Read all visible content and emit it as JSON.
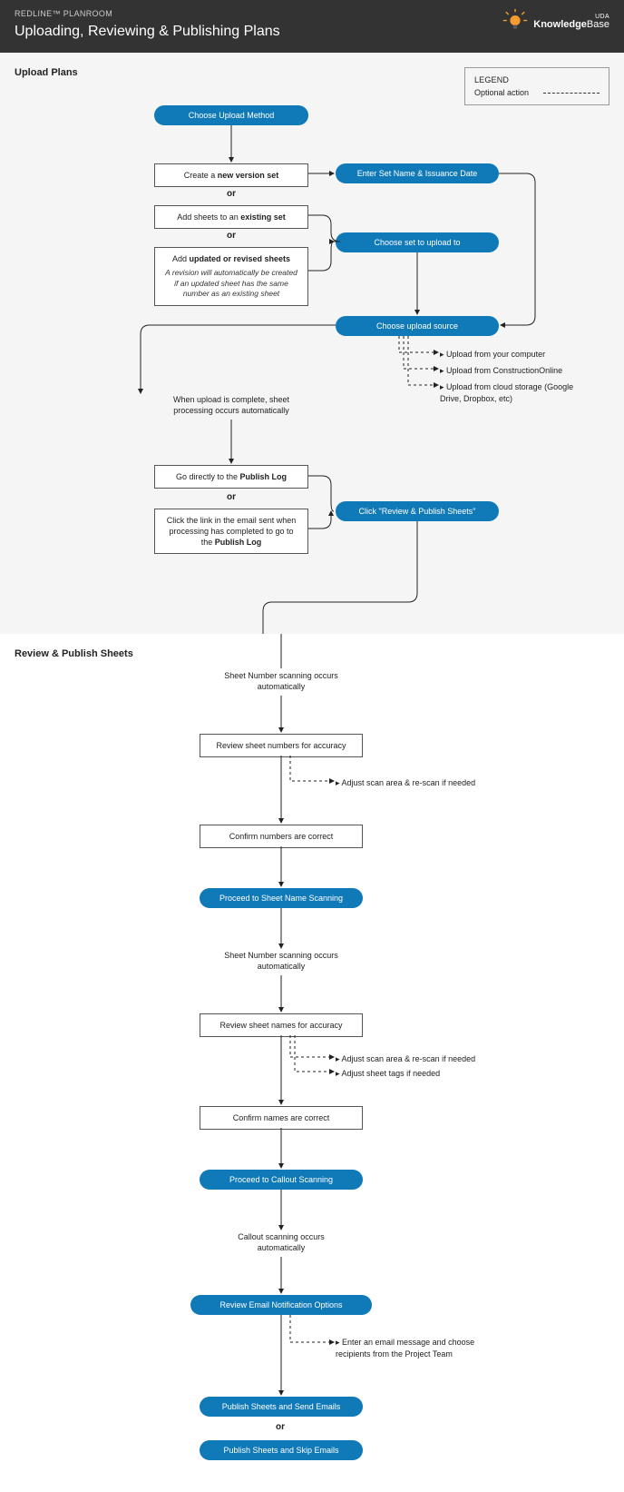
{
  "header": {
    "breadcrumb": "REDLINE™ PLANROOM",
    "title": "Uploading, Reviewing & Publishing Plans",
    "kb_small": "UDA",
    "kb_big_a": "Knowledge",
    "kb_big_b": "Base"
  },
  "legend": {
    "title": "LEGEND",
    "optional": "Optional action"
  },
  "section1": {
    "title": "Upload Plans",
    "choose_method": "Choose Upload Method",
    "new_set_pre": "Create a ",
    "new_set_bold": "new version set",
    "or": "or",
    "existing_pre": "Add sheets to an ",
    "existing_bold": "existing set",
    "revised_pre": "Add ",
    "revised_bold": "updated or revised sheets",
    "revised_sub": "A revision will automatically be created if an updated sheet has the same number as an existing sheet",
    "enter_name": "Enter Set Name & Issuance Date",
    "choose_set": "Choose set to upload to",
    "choose_source": "Choose upload source",
    "src1": "Upload from your computer",
    "src2": "Upload from ConstructionOnline",
    "src3": "Upload from cloud storage (Google Drive, Dropbox, etc)",
    "when_complete": "When upload is complete, sheet processing occurs automatically",
    "go_direct_pre": "Go directly to the ",
    "go_direct_bold": "Publish Log",
    "email_pre": "Click the link in the email sent when processing has completed to go to the ",
    "email_bold": "Publish Log",
    "review_publish": "Click \"Review & Publish Sheets\""
  },
  "section2": {
    "title": "Review & Publish Sheets",
    "num_scan": "Sheet Number scanning occurs automatically",
    "review_num": "Review sheet numbers for accuracy",
    "adjust_scan": "Adjust scan area & re-scan if needed",
    "confirm_num": "Confirm numbers are correct",
    "proceed_name": "Proceed to Sheet Name Scanning",
    "name_scan": "Sheet Number scanning occurs automatically",
    "review_name": "Review sheet names for accuracy",
    "adjust_scan2": "Adjust scan area & re-scan if needed",
    "adjust_tags": "Adjust sheet tags if needed",
    "confirm_name": "Confirm names are correct",
    "proceed_callout": "Proceed to Callout Scanning",
    "callout_scan": "Callout scanning occurs automatically",
    "review_email": "Review Email Notification Options",
    "email_note": "Enter an email message and choose recipients from the Project Team",
    "pub_send": "Publish Sheets and Send Emails",
    "pub_skip": "Publish Sheets and Skip Emails"
  }
}
